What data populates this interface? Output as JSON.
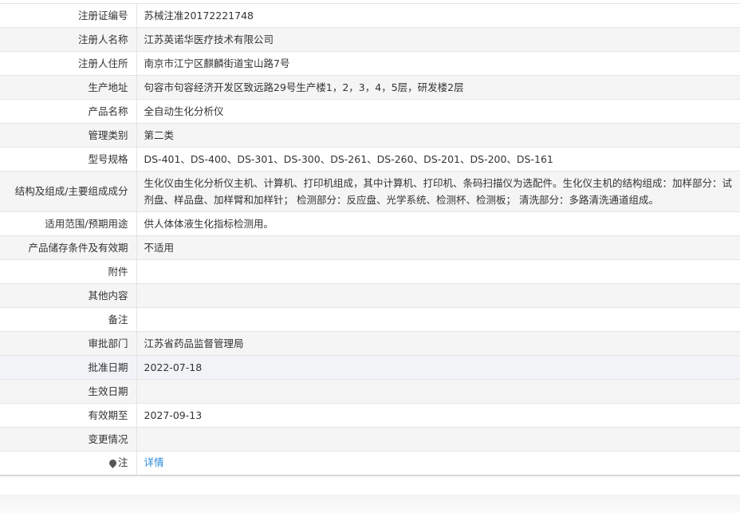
{
  "rows": [
    {
      "label": "注册证编号",
      "value": "苏械注准20172221748"
    },
    {
      "label": "注册人名称",
      "value": "江苏英诺华医疗技术有限公司"
    },
    {
      "label": "注册人住所",
      "value": "南京市江宁区麒麟街道宝山路7号"
    },
    {
      "label": "生产地址",
      "value": "句容市句容经济开发区致远路29号生产楼1，2，3，4，5层，研发楼2层"
    },
    {
      "label": "产品名称",
      "value": "全自动生化分析仪"
    },
    {
      "label": "管理类别",
      "value": "第二类"
    },
    {
      "label": "型号规格",
      "value": "DS-401、DS-400、DS-301、DS-300、DS-261、DS-260、DS-201、DS-200、DS-161"
    },
    {
      "label": "结构及组成/主要组成成分",
      "value": "生化仪由生化分析仪主机、计算机、打印机组成，其中计算机、打印机、条码扫描仪为选配件。生化仪主机的结构组成：加样部分：试剂盘、样品盘、加样臂和加样针； 检测部分：反应盘、光学系统、检测杯、检测板； 清洗部分：多路清洗通道组成。"
    },
    {
      "label": "适用范围/预期用途",
      "value": "供人体体液生化指标检测用。"
    },
    {
      "label": "产品储存条件及有效期",
      "value": "不适用"
    },
    {
      "label": "附件",
      "value": ""
    },
    {
      "label": "其他内容",
      "value": ""
    },
    {
      "label": "备注",
      "value": ""
    },
    {
      "label": "审批部门",
      "value": "江苏省药品监督管理局"
    },
    {
      "label": "批准日期",
      "value": "2022-07-18"
    },
    {
      "label": "生效日期",
      "value": ""
    },
    {
      "label": "有效期至",
      "value": "2027-09-13"
    },
    {
      "label": "变更情况",
      "value": ""
    }
  ],
  "note": {
    "label": "注",
    "icon": "location-pin-icon",
    "link_text": "详情",
    "link_color": "#2c8ad8"
  }
}
